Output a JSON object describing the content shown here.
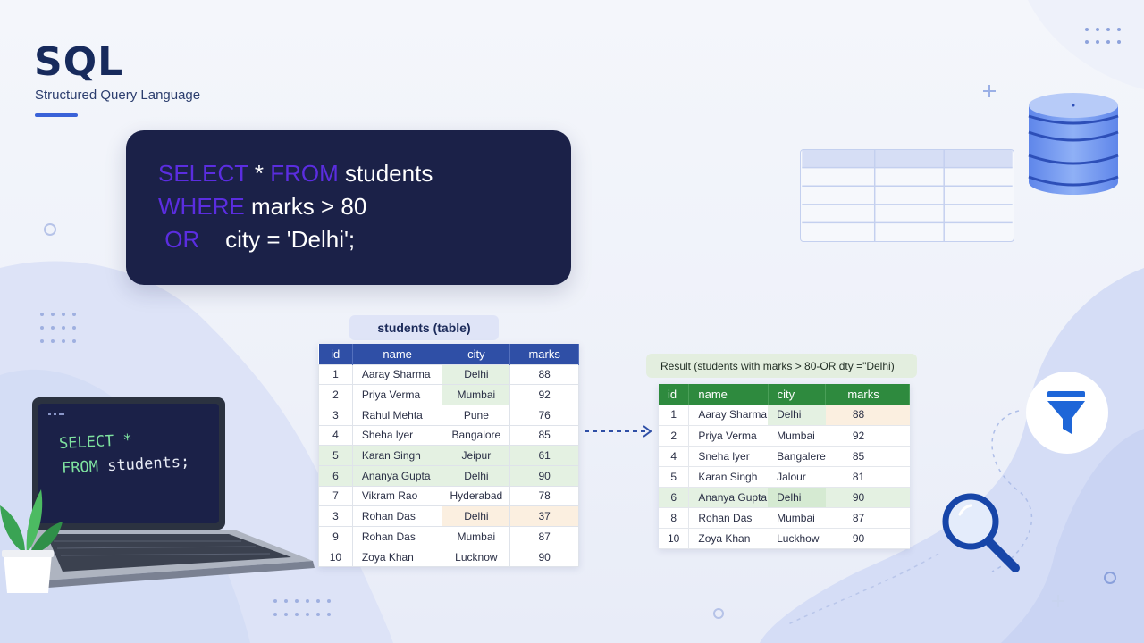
{
  "header": {
    "title": "SQL",
    "subtitle": "Structured Query Language"
  },
  "code_panel": {
    "lines": [
      {
        "kw": "SELECT",
        "rest": " * ",
        "kw2": "FROM",
        "rest2": " students"
      },
      {
        "kw": "WHERE",
        "rest": " marks > 80",
        "kw2": "",
        "rest2": ""
      },
      {
        "kw": " OR",
        "rest": "    city = 'Delhi';",
        "kw2": "",
        "rest2": ""
      }
    ]
  },
  "laptop": {
    "line1": "SELECT *",
    "line2": "FROM",
    "line2_rest": " students;"
  },
  "source_table": {
    "caption": "students (table)",
    "headers": [
      "id",
      "name",
      "city",
      "marks"
    ],
    "rows": [
      [
        "1",
        "Aaray Sharma",
        "Delhi",
        "88"
      ],
      [
        "2",
        "Priya Verma",
        "Mumbai",
        "92"
      ],
      [
        "3",
        "Rahul Mehta",
        "Pune",
        "76"
      ],
      [
        "4",
        "Sheha lyer",
        "Bangalore",
        "85"
      ],
      [
        "5",
        "Karan Singh",
        "Jeipur",
        "61"
      ],
      [
        "6",
        "Ananya Gupta",
        "Delhi",
        "90"
      ],
      [
        "7",
        "Vikram Rao",
        "Hyderabad",
        "78"
      ],
      [
        "3",
        "Rohan Das",
        "Delhi",
        "37"
      ],
      [
        "9",
        "Rohan Das",
        "Mumbai",
        "87"
      ],
      [
        "10",
        "Zoya Khan",
        "Lucknow",
        "90"
      ]
    ]
  },
  "result_table": {
    "caption": "Result (students with marks > 80-OR dty =\"Delhi)",
    "headers": [
      "id",
      "name",
      "city",
      "marks"
    ],
    "rows": [
      [
        "1",
        "Aaray Sharma",
        "Delhi",
        "88"
      ],
      [
        "2",
        "Priya Verma",
        "Mumbai",
        "92"
      ],
      [
        "4",
        "Sneha lyer",
        "Bangalere",
        "85"
      ],
      [
        "5",
        "Karan Singh",
        "Jalour",
        "81"
      ],
      [
        "6",
        "Ananya Gupta",
        "Delhi",
        "90"
      ],
      [
        "8",
        "Rohan Das",
        "Mumbai",
        "87"
      ],
      [
        "10",
        "Zoya Khan",
        "Luckhow",
        "90"
      ]
    ]
  },
  "colors": {
    "navy": "#1b2148",
    "keyword": "#5b2de0",
    "table_header_blue": "#2f4fa6",
    "table_header_green": "#2e8a3e",
    "accent": "#3a62d8"
  },
  "icons": [
    "database-icon",
    "funnel-icon",
    "magnifier-icon",
    "laptop-icon",
    "plant-icon",
    "table-grid-icon",
    "dashed-arrow-icon"
  ]
}
